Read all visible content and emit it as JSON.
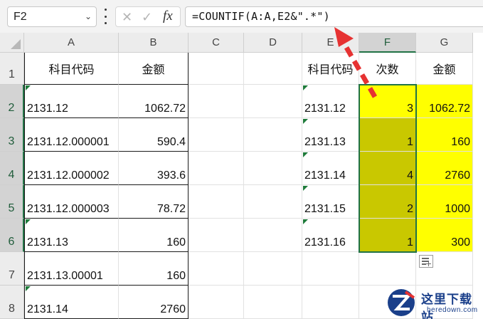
{
  "formula_bar": {
    "name_box": "F2",
    "fx_label": "fx",
    "formula": "=COUNTIF(A:A,E2&\".*\")"
  },
  "columns": [
    "A",
    "B",
    "C",
    "D",
    "E",
    "F",
    "G"
  ],
  "rows": [
    "1",
    "2",
    "3",
    "4",
    "5",
    "6",
    "7",
    "8"
  ],
  "left_table": {
    "headers": [
      "科目代码",
      "金额"
    ],
    "rows": [
      [
        "2131.12",
        "1062.72"
      ],
      [
        "2131.12.000001",
        "590.4"
      ],
      [
        "2131.12.000002",
        "393.6"
      ],
      [
        "2131.12.000003",
        "78.72"
      ],
      [
        "2131.13",
        "160"
      ],
      [
        "2131.13.00001",
        "160"
      ],
      [
        "2131.14",
        "2760"
      ]
    ]
  },
  "right_table": {
    "headers": [
      "科目代码",
      "次数",
      "金额"
    ],
    "rows": [
      [
        "2131.12",
        "3",
        "1062.72"
      ],
      [
        "2131.13",
        "1",
        "160"
      ],
      [
        "2131.14",
        "4",
        "2760"
      ],
      [
        "2131.15",
        "2",
        "1000"
      ],
      [
        "2131.16",
        "1",
        "300"
      ]
    ]
  },
  "selected_cell": "F2",
  "colors": {
    "selection": "#217346",
    "yellow_fill": "#ffff00",
    "olive_fill": "#c9c800",
    "arrow": "#e63232"
  },
  "icons": {
    "cancel": "x-icon",
    "confirm": "check-icon",
    "quick_analysis": "quick-analysis-icon",
    "arrow": "red-dashed-arrow"
  },
  "watermark": {
    "title": "这里下载站",
    "url": "heredown.com"
  }
}
